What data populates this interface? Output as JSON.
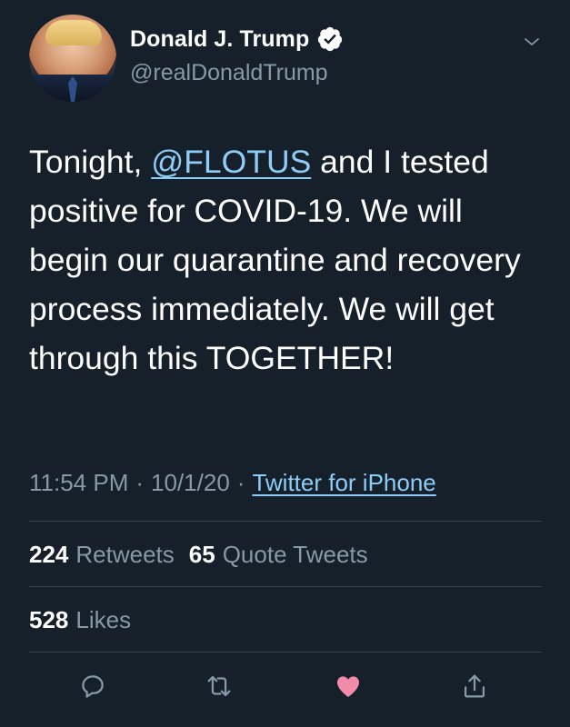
{
  "tweet": {
    "author": {
      "display_name": "Donald J. Trump",
      "handle": "@realDonaldTrump",
      "verified": true,
      "avatar_icon": "profile-photo"
    },
    "text": {
      "prefix": "Tonight, ",
      "mention": "@FLOTUS",
      "suffix": " and I tested positive for COVID-19. We will begin our quarantine and recovery process immediately. We will get through this TOGETHER!"
    },
    "meta": {
      "time": "11:54 PM",
      "separator_1": "·",
      "date": "10/1/20",
      "separator_2": "·",
      "source": "Twitter for iPhone"
    },
    "stats": {
      "retweets_count": "224",
      "retweets_label": "Retweets",
      "quote_tweets_count": "65",
      "quote_tweets_label": "Quote Tweets",
      "likes_count": "528",
      "likes_label": "Likes"
    },
    "actions": [
      {
        "name": "reply",
        "icon": "speech-bubble-icon"
      },
      {
        "name": "retweet",
        "icon": "retweet-arrows-icon"
      },
      {
        "name": "like",
        "icon": "heart-icon",
        "active": true
      },
      {
        "name": "share",
        "icon": "share-upload-icon"
      }
    ]
  },
  "colors": {
    "background": "#15202b",
    "text_primary": "#ffffff",
    "text_secondary": "#8899a6",
    "link": "#8ecdf8",
    "divider": "#38444d",
    "like_active": "#e0245e"
  }
}
